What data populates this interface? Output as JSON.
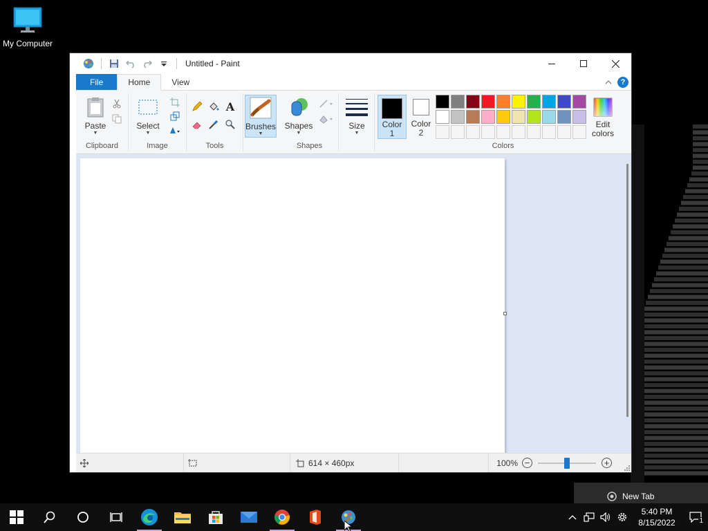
{
  "desktop": {
    "icon_label": "My Computer"
  },
  "window": {
    "title": "Untitled - Paint",
    "tabs": [
      {
        "label": "File"
      },
      {
        "label": "Home"
      },
      {
        "label": "View"
      }
    ],
    "help_label": "?"
  },
  "ribbon": {
    "groups": {
      "clipboard": "Clipboard",
      "image": "Image",
      "tools": "Tools",
      "shapes": "Shapes",
      "colors": "Colors"
    },
    "buttons": {
      "paste": "Paste",
      "select": "Select",
      "brushes": "Brushes",
      "shapes": "Shapes",
      "size": "Size",
      "color1_line1": "Color",
      "color1_line2": "1",
      "color2_line1": "Color",
      "color2_line2": "2",
      "edit_colors_line1": "Edit",
      "edit_colors_line2": "colors"
    },
    "color1": "#000000",
    "color2": "#ffffff",
    "palette": [
      "#000000",
      "#7f7f7f",
      "#880015",
      "#ed1c24",
      "#ff7f27",
      "#fff200",
      "#22b14c",
      "#00a2e8",
      "#3f48cc",
      "#a349a4",
      "#ffffff",
      "#c3c3c3",
      "#b97a57",
      "#ffaec9",
      "#ffc90e",
      "#efe4b0",
      "#b5e61d",
      "#99d9ea",
      "#7092be",
      "#c8bfe7",
      "#f5f5f5",
      "#f5f5f5",
      "#f5f5f5",
      "#f5f5f5",
      "#f5f5f5",
      "#f5f5f5",
      "#f5f5f5",
      "#f5f5f5",
      "#f5f5f5",
      "#f5f5f5"
    ]
  },
  "status": {
    "image_size": "614 × 460px",
    "zoom": "100%"
  },
  "taskbar": {
    "time": "5:40 PM",
    "date": "8/15/2022",
    "notification_count": "1",
    "popup_label": "New Tab"
  }
}
